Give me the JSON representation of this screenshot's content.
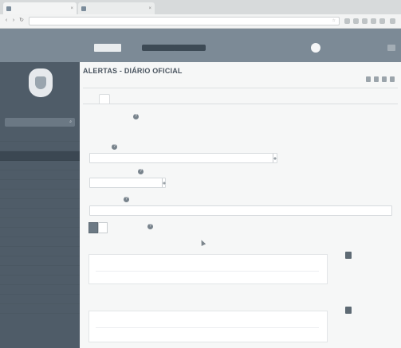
{
  "browser": {
    "tabs": [
      {
        "label": ""
      },
      {
        "label": ""
      }
    ],
    "url": ""
  },
  "topbar": {
    "brand": "",
    "chip1": "",
    "chip2": "",
    "center_text": "",
    "user_name": ""
  },
  "sidebar": {
    "org_name": "",
    "search_placeholder": "",
    "items": [
      {
        "label": ""
      },
      {
        "label": ""
      },
      {
        "label": ""
      },
      {
        "label": ""
      },
      {
        "label": ""
      },
      {
        "label": ""
      },
      {
        "label": ""
      },
      {
        "label": ""
      },
      {
        "label": ""
      },
      {
        "label": ""
      },
      {
        "label": ""
      },
      {
        "label": ""
      },
      {
        "label": ""
      },
      {
        "label": ""
      },
      {
        "label": ""
      },
      {
        "label": ""
      },
      {
        "label": ""
      },
      {
        "label": ""
      },
      {
        "label": ""
      }
    ]
  },
  "page": {
    "title": "ALERTAS - DIÁRIO OFICIAL",
    "crumbs": "",
    "tabs": [
      {
        "label": ""
      },
      {
        "label": ""
      },
      {
        "label": ""
      }
    ],
    "section_title": "",
    "field1": {
      "label": "",
      "placeholder": ""
    },
    "field2": {
      "label": "",
      "placeholder": ""
    },
    "field3": {
      "label": "",
      "placeholder": ""
    },
    "toggle": {
      "on_label": "",
      "off_label": ""
    },
    "panel1": {
      "label": "",
      "button": ""
    },
    "panel2": {
      "label": "",
      "button": ""
    }
  }
}
